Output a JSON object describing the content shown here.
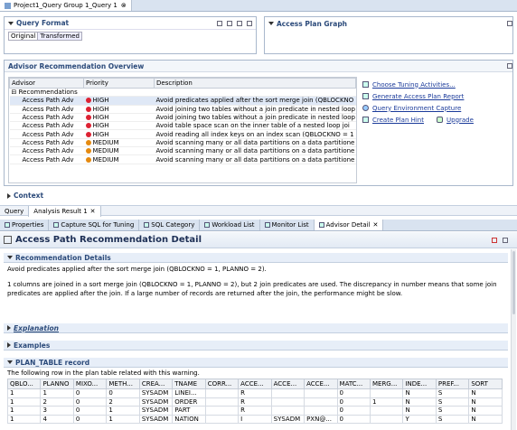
{
  "editor_tab": {
    "label": "Project1_Query Group 1_Query 1",
    "close": "⊗"
  },
  "query_format": {
    "title": "Query Format",
    "tabs": [
      "Original",
      "Transformed"
    ]
  },
  "access_plan_graph": {
    "title": "Access Plan Graph"
  },
  "advisor_overview": {
    "title": "Advisor Recommendation Overview",
    "columns": [
      "Advisor",
      "Priority",
      "Description"
    ],
    "group_label": "Recommendations",
    "rows": [
      {
        "advisor": "Access Path Adv",
        "priority": "HIGH",
        "level": "high",
        "description": "Avoid predicates applied after the sort merge join (QBLOCKNO"
      },
      {
        "advisor": "Access Path Adv",
        "priority": "HIGH",
        "level": "high",
        "description": "Avoid joining two tables without a join predicate in nested loop"
      },
      {
        "advisor": "Access Path Adv",
        "priority": "HIGH",
        "level": "high",
        "description": "Avoid joining two tables without a join predicate in nested loop"
      },
      {
        "advisor": "Access Path Adv",
        "priority": "HIGH",
        "level": "high",
        "description": "Avoid table space scan on the inner table of a nested loop joi"
      },
      {
        "advisor": "Access Path Adv",
        "priority": "HIGH",
        "level": "high",
        "description": "Avoid reading all index keys on an index scan (QBLOCKNO = 1"
      },
      {
        "advisor": "Access Path Adv",
        "priority": "MEDIUM",
        "level": "medium",
        "description": "Avoid scanning many or all data partitions on a data partitione"
      },
      {
        "advisor": "Access Path Adv",
        "priority": "MEDIUM",
        "level": "medium",
        "description": "Avoid scanning many or all data partitions on a data partitione"
      },
      {
        "advisor": "Access Path Adv",
        "priority": "MEDIUM",
        "level": "medium",
        "description": "Avoid scanning many or all data partitions on a data partitione"
      }
    ],
    "links": [
      "Choose Tuning Activities...",
      "Generate Access Plan Report",
      "Query Environment Capture",
      "Create Plan Hint",
      "Upgrade"
    ]
  },
  "context": {
    "title": "Context"
  },
  "query_tabs": [
    "Query",
    "Analysis Result 1"
  ],
  "view_tabs": [
    "Properties",
    "Capture SQL for Tuning",
    "SQL Category",
    "Workload List",
    "Monitor List",
    "Advisor Detail"
  ],
  "detail": {
    "title": "Access Path Recommendation Detail",
    "rec_details_title": "Recommendation Details",
    "summary": "Avoid predicates applied after the sort merge join (QBLOCKNO = 1, PLANNO = 2).",
    "body": "1 columns are joined in a sort merge join (QBLOCKNO = 1, PLANNO = 2), but 2 join predicates are used. The discrepancy in number means that some join predicates are applied after the join. If a large number of records are returned after the join, the performance might be slow.",
    "explanation_title": "Explanation",
    "examples_title": "Examples",
    "plan_table_title": "PLAN_TABLE record",
    "plan_table_desc": "The following row in the plan table related with this warning.",
    "plan_columns": [
      "QBLO...",
      "PLANNO",
      "MIXO...",
      "METH...",
      "CREA...",
      "TNAME",
      "CORR...",
      "ACCE...",
      "ACCE...",
      "ACCE...",
      "MATC...",
      "MERG...",
      "INDE...",
      "PREF...",
      "SORT"
    ],
    "plan_rows": [
      [
        "1",
        "1",
        "0",
        "0",
        "SYSADM",
        "LINEI...",
        "",
        "R",
        "",
        "",
        "0",
        "",
        "N",
        "S",
        "N"
      ],
      [
        "1",
        "2",
        "0",
        "2",
        "SYSADM",
        "ORDER",
        "",
        "R",
        "",
        "",
        "0",
        "1",
        "N",
        "S",
        "N"
      ],
      [
        "1",
        "3",
        "0",
        "1",
        "SYSADM",
        "PART",
        "",
        "R",
        "",
        "",
        "0",
        "",
        "N",
        "S",
        "N"
      ],
      [
        "1",
        "4",
        "0",
        "1",
        "SYSADM",
        "NATION",
        "",
        "I",
        "SYSADM",
        "PXN@...",
        "0",
        "",
        "Y",
        "S",
        "N"
      ]
    ]
  }
}
